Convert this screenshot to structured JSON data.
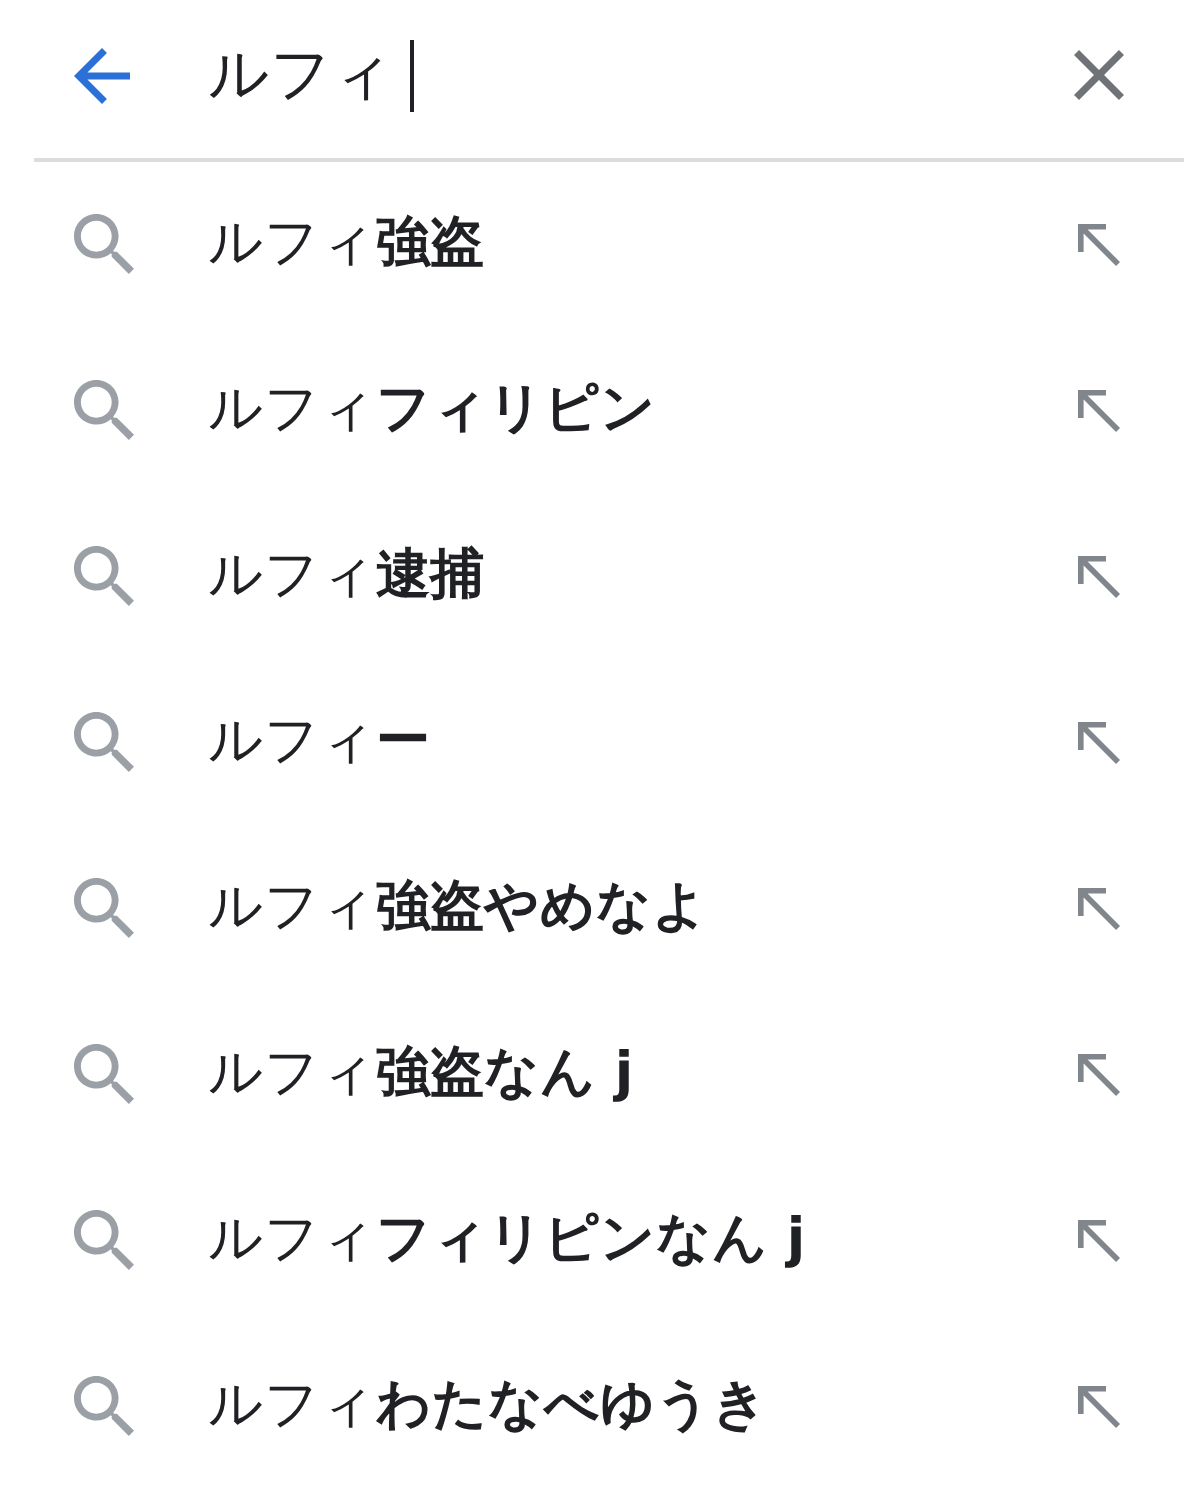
{
  "search": {
    "value": "ルフィ",
    "focused": true
  },
  "suggestions": [
    {
      "text": "ルフィ**強盗**"
    },
    {
      "text": "ルフィ**フィリピン**"
    },
    {
      "text": "ルフィ**逮捕**"
    },
    {
      "text": "ルフィ**ー**"
    },
    {
      "text": "ルフィ**強盗やめなよ**"
    },
    {
      "text": "ルフィ**強盗なん j**"
    },
    {
      "text": "ルフィ**フィリピンなん j**"
    },
    {
      "text": "ルフィ**わたなべゆうき**"
    }
  ]
}
